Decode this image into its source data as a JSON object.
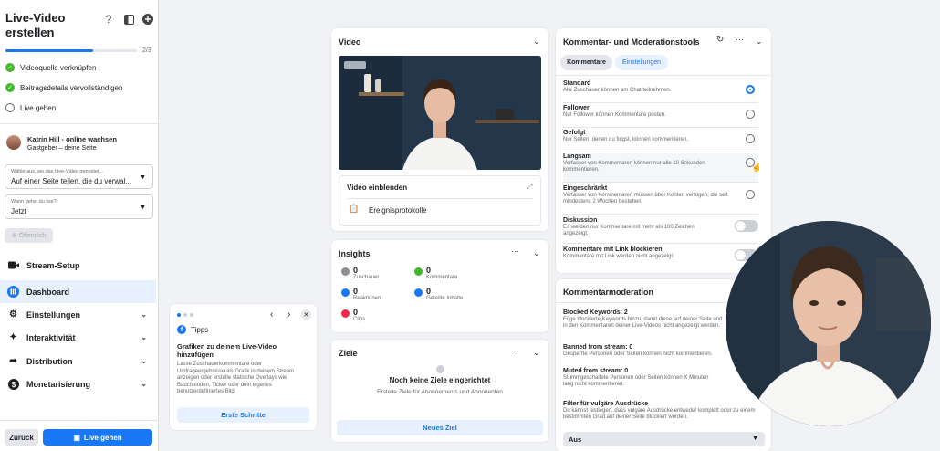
{
  "sidebar": {
    "title_line1": "Live-Video",
    "title_line2": "erstellen",
    "progress": {
      "label": "2/3",
      "fraction": 0.667
    },
    "steps": [
      {
        "label": "Videoquelle verknüpfen",
        "done": true
      },
      {
        "label": "Beitragsdetails vervollständigen",
        "done": true
      },
      {
        "label": "Live gehen",
        "done": false
      }
    ],
    "host": {
      "name": "Katrin Hill - online wachsen",
      "role": "Gastgeber – deine Seite"
    },
    "post_where": {
      "label": "Wähle aus, wo das Live-Video gepostet...",
      "value": "Auf einer Seite teilen, die du verwal..."
    },
    "when": {
      "label": "Wann gehst du live?",
      "value": "Jetzt"
    },
    "audience": "Öffentlich",
    "nav": [
      {
        "label": "Stream-Setup",
        "icon": "video-camera-icon"
      },
      {
        "label": "Dashboard",
        "icon": "dashboard-icon"
      },
      {
        "label": "Einstellungen",
        "icon": "gear-icon"
      },
      {
        "label": "Interaktivität",
        "icon": "sparkle-icon"
      },
      {
        "label": "Distribution",
        "icon": "share-arrow-icon"
      },
      {
        "label": "Monetarisierung",
        "icon": "dollar-icon"
      }
    ],
    "back_label": "Zurück",
    "go_live_label": "Live gehen"
  },
  "tips": {
    "header": "Tipps",
    "title": "Grafiken zu deinem Live-Video hinzufügen",
    "body": "Lasse Zuschauerkommentare oder Umfrageergebnisse als Grafik in deinem Stream anzeigen oder erstelle statische Overlays wie Bauchbinden, Ticker oder dein eigenes benutzerdefiniertes Bild.",
    "button": "Erste Schritte"
  },
  "video": {
    "title": "Video",
    "show_video": "Video einblenden",
    "event_log": "Ereignisprotokolle"
  },
  "insights": {
    "title": "Insights",
    "items": [
      {
        "value": "0",
        "label": "Zuschauer",
        "color": "#8a8d91"
      },
      {
        "value": "0",
        "label": "Kommentare",
        "color": "#42b72a"
      },
      {
        "value": "0",
        "label": "Reaktionen",
        "color": "#1877f2"
      },
      {
        "value": "0",
        "label": "Geteilte Inhalte",
        "color": "#1877f2"
      },
      {
        "value": "0",
        "label": "Clips",
        "color": "#f02849"
      }
    ]
  },
  "goals": {
    "title": "Ziele",
    "empty_title": "Noch keine Ziele eingerichtet",
    "empty_desc": "Erstelle Ziele für Abonnements und Abonnenten",
    "button": "Neues Ziel"
  },
  "comments": {
    "title": "Kommentar- und Moderationstools",
    "tabs": [
      "Kommentare",
      "Einstellungen"
    ],
    "options": [
      {
        "title": "Standard",
        "desc": "Alle Zuschauer können am Chat teilnehmen.",
        "type": "radio",
        "selected": true
      },
      {
        "title": "Follower",
        "desc": "Nur Follower können Kommentare posten.",
        "type": "radio",
        "selected": false
      },
      {
        "title": "Gefolgt",
        "desc": "Nur Seiten, denen du folgst, können kommentieren.",
        "type": "radio",
        "selected": false
      },
      {
        "title": "Langsam",
        "desc": "Verfasser von Kommentaren können nur alle 10 Sekunden kommentieren.",
        "type": "radio",
        "selected": false
      },
      {
        "title": "Eingeschränkt",
        "desc": "Verfasser von Kommentaren müssen über Konten verfügen, die seit mindestens 2 Wochen bestehen.",
        "type": "radio",
        "selected": false
      },
      {
        "title": "Diskussion",
        "desc": "Es werden nur Kommentare mit mehr als 100 Zeichen angezeigt.",
        "type": "toggle",
        "selected": false
      },
      {
        "title": "Kommentare mit Link blockieren",
        "desc": "Kommentare mit Link werden nicht angezeigt.",
        "type": "toggle",
        "selected": false
      }
    ]
  },
  "moderation": {
    "title": "Kommentarmoderation",
    "sections": [
      {
        "title": "Blocked Keywords: 2",
        "desc": "Füge blockierte Keywords hinzu, damit diese auf deiner Seite und in den Kommentaren deiner Live-Videos nicht angezeigt werden."
      },
      {
        "title": "Banned from stream: 0",
        "desc": "Gesperrte Personen oder Seiten können nicht kommentieren."
      },
      {
        "title": "Muted from stream: 0",
        "desc": "Stummgeschaltete Personen oder Seiten können X Minuten lang nicht kommentieren."
      },
      {
        "title": "Filter für vulgäre Ausdrücke",
        "desc": "Du kannst festlegen, dass vulgäre Ausdrücke entweder komplett oder zu einem bestimmten Grad auf deiner Seite blockiert werden."
      }
    ],
    "filter_value": "Aus"
  },
  "colors": {
    "accent": "#1877f2",
    "active_nav": "#e7f0fd",
    "success": "#42b72a"
  }
}
